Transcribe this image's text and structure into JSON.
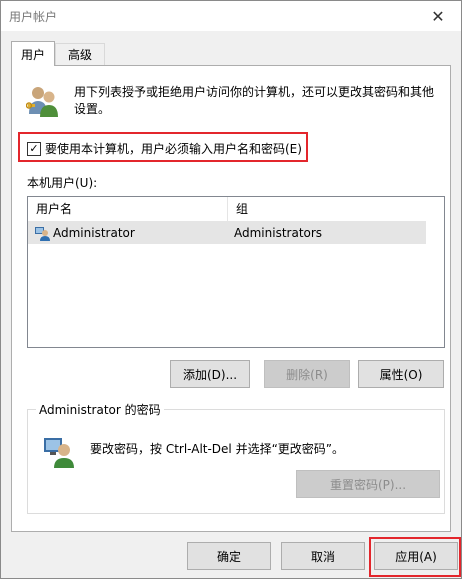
{
  "window": {
    "title": "用户帐户",
    "close_glyph": "✕"
  },
  "tabs": [
    {
      "label": "用户",
      "active": true
    },
    {
      "label": "高级",
      "active": false
    }
  ],
  "intro": {
    "text": "用下列表授予或拒绝用户访问你的计算机，还可以更改其密码和其他设置。",
    "icon": "users-icon"
  },
  "require_login": {
    "label": "要使用本计算机，用户必须输入用户名和密码(E)",
    "checked": true,
    "check_glyph": "✓"
  },
  "local_users": {
    "label": "本机用户(U):",
    "columns": [
      "用户名",
      "组"
    ],
    "rows": [
      {
        "name": "Administrator",
        "group": "Administrators",
        "selected": true
      }
    ]
  },
  "user_buttons": {
    "add": "添加(D)...",
    "remove": "删除(R)",
    "properties": "属性(O)"
  },
  "password_group": {
    "title": "Administrator 的密码",
    "text": "要改密码，按 Ctrl-Alt-Del 并选择“更改密码”。",
    "reset_button": "重置密码(P)..."
  },
  "dialog_buttons": {
    "ok": "确定",
    "cancel": "取消",
    "apply": "应用(A)"
  },
  "colors": {
    "highlight": "#e3262c",
    "window_bg": "#f0f0f0",
    "selected_row": "#e5e5e5"
  }
}
